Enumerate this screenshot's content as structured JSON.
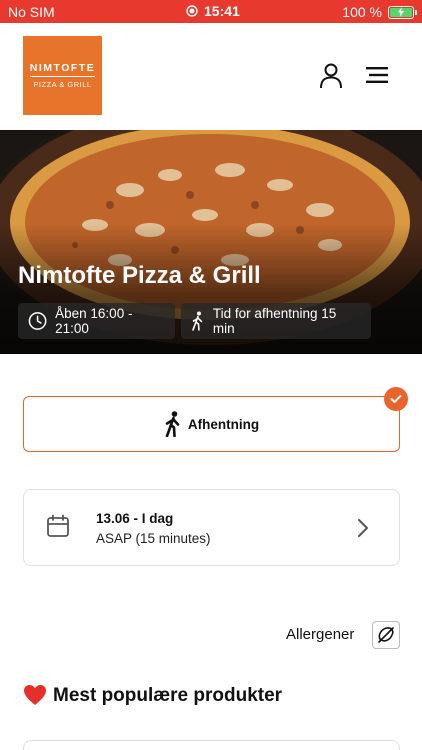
{
  "status_bar": {
    "carrier": "No SIM",
    "time": "15:41",
    "battery": "100 %"
  },
  "header": {
    "logo_line1": "NIMTOFTE",
    "logo_line2": "PIZZA & GRILL",
    "user_icon": "user-icon",
    "menu_icon": "hamburger-menu-icon"
  },
  "hero": {
    "title": "Nimtofte Pizza & Grill",
    "hours": "Åben 16:00 - 21:00",
    "pickup_time": "Tid for afhentning 15 min"
  },
  "order_type": {
    "label": "Afhentning",
    "selected": true
  },
  "schedule": {
    "date": "13.06 - I dag",
    "time": "ASAP (15 minutes)"
  },
  "allergens": {
    "label": "Allergener"
  },
  "popular": {
    "title": "Mest populære produkter"
  },
  "colors": {
    "brand_red": "#e8392e",
    "accent_orange": "#e8642a",
    "logo_orange": "#e8732a"
  }
}
